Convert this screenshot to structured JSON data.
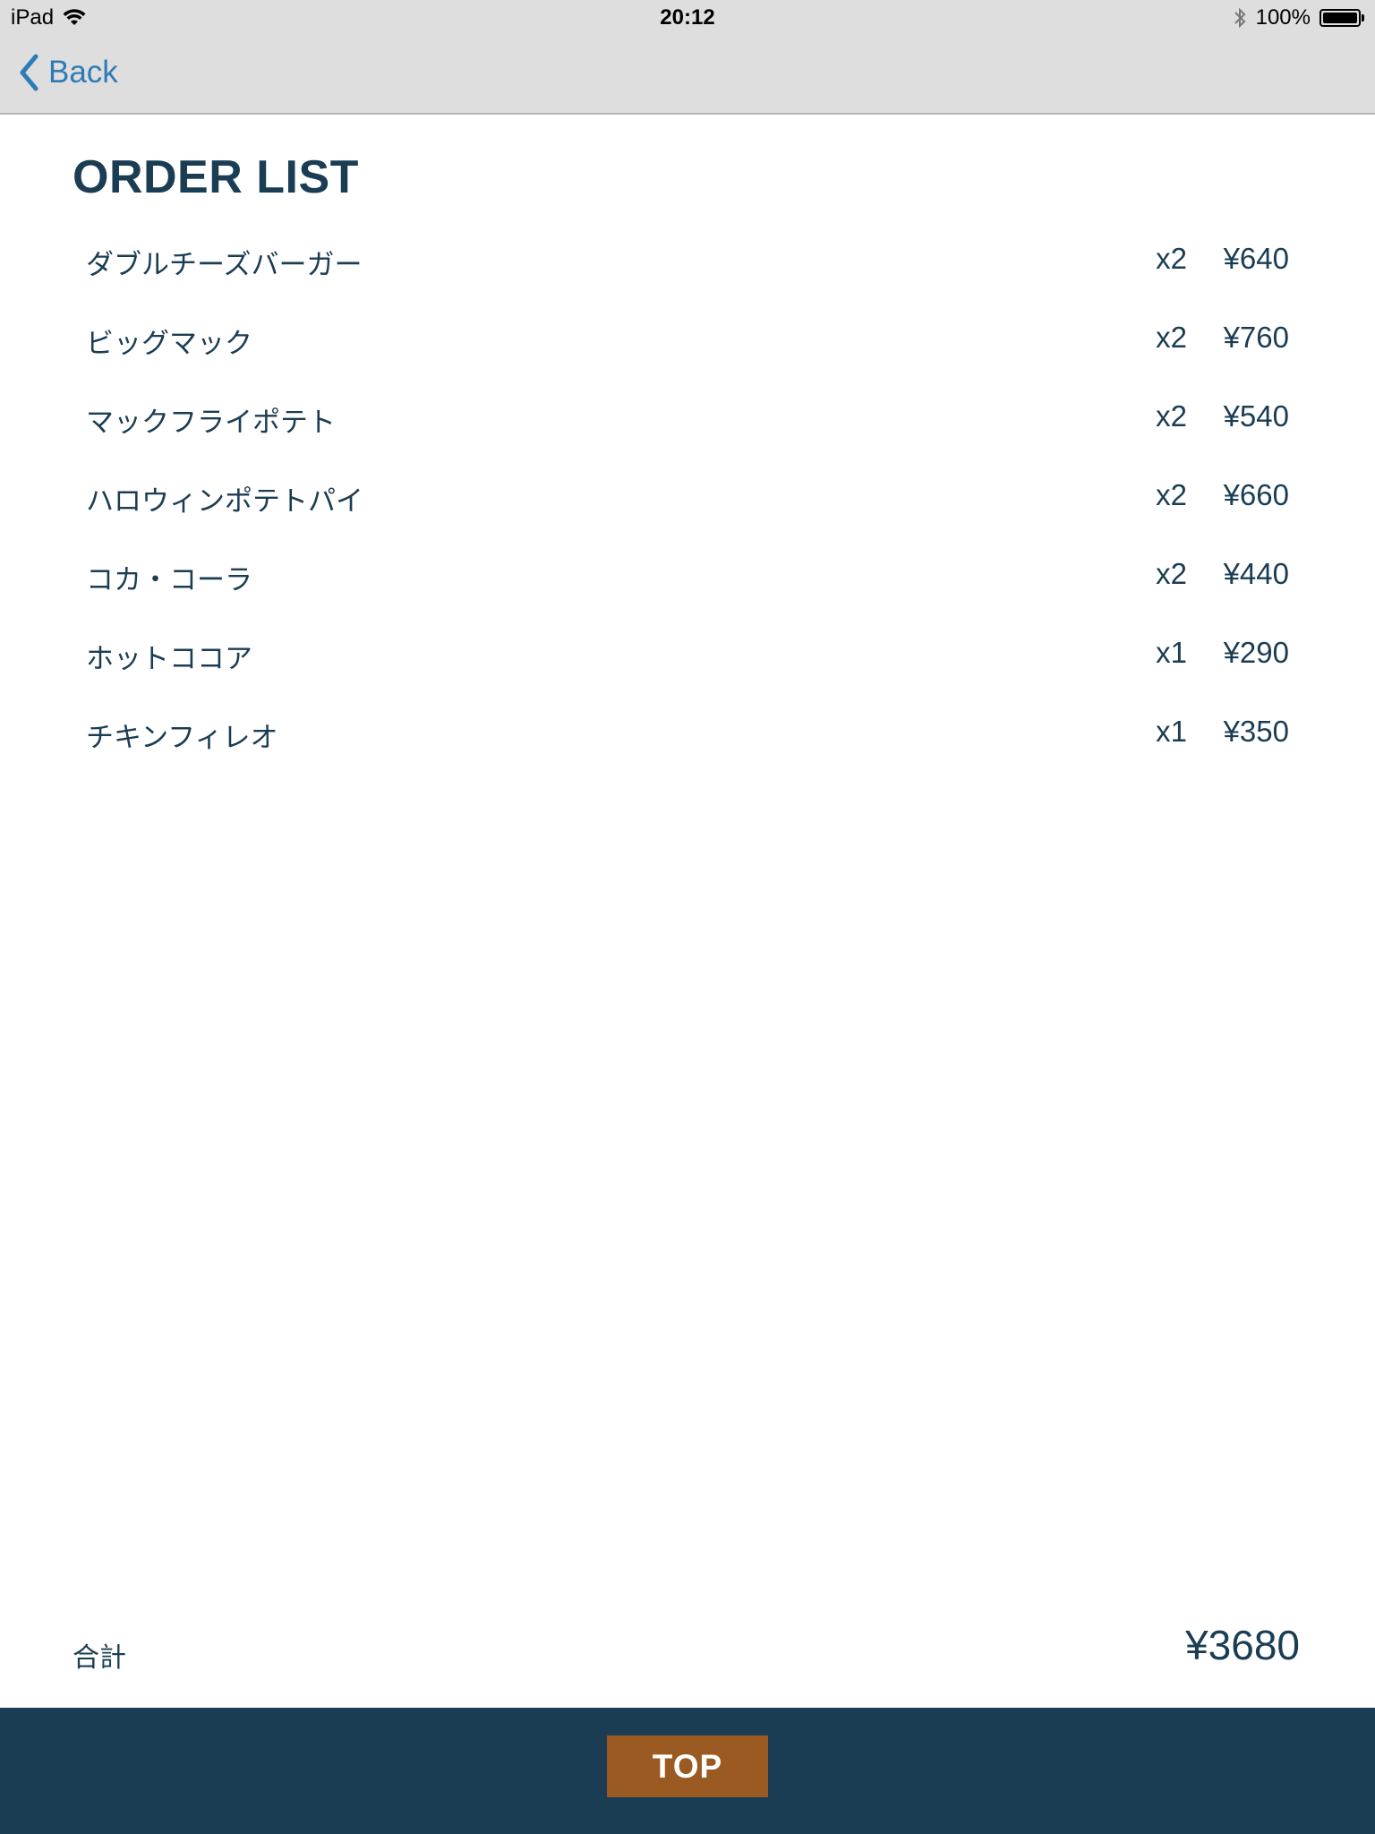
{
  "status_bar": {
    "device": "iPad",
    "time": "20:12",
    "battery": "100%"
  },
  "nav": {
    "back_label": "Back"
  },
  "page_title": "ORDER LIST",
  "orders": [
    {
      "name": "ダブルチーズバーガー",
      "qty": "x2",
      "price": "¥640"
    },
    {
      "name": "ビッグマック",
      "qty": "x2",
      "price": "¥760"
    },
    {
      "name": "マックフライポテト",
      "qty": "x2",
      "price": "¥540"
    },
    {
      "name": "ハロウィンポテトパイ",
      "qty": "x2",
      "price": "¥660"
    },
    {
      "name": "コカ・コーラ",
      "qty": "x2",
      "price": "¥440"
    },
    {
      "name": "ホットココア",
      "qty": "x1",
      "price": "¥290"
    },
    {
      "name": "チキンフィレオ",
      "qty": "x1",
      "price": "¥350"
    }
  ],
  "total": {
    "label": "合計",
    "value": "¥3680"
  },
  "footer": {
    "top_button_label": "TOP"
  },
  "colors": {
    "primary": "#1b3d53",
    "accent": "#9a5a21",
    "link": "#2e7cb5"
  }
}
